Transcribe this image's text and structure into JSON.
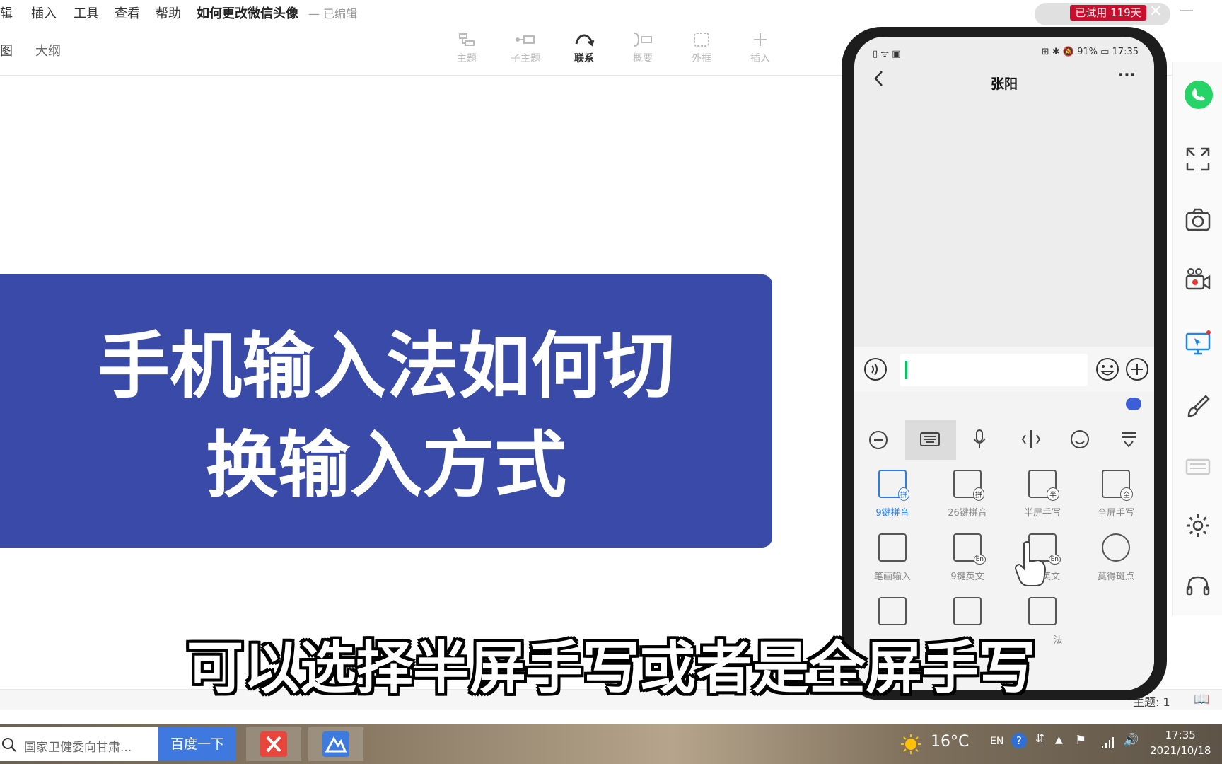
{
  "menu": {
    "items": [
      "辑",
      "插入",
      "工具",
      "查看",
      "帮助"
    ],
    "doc_title": "如何更改微信头像",
    "doc_status": "— 已编辑"
  },
  "trial": {
    "label": "已试用 119天"
  },
  "views": [
    "图",
    "大纲"
  ],
  "toolbar": {
    "tools": [
      {
        "label": "主题"
      },
      {
        "label": "子主题"
      },
      {
        "label": "联系"
      },
      {
        "label": "概要"
      },
      {
        "label": "外框"
      },
      {
        "label": "插入"
      }
    ]
  },
  "canvas": {
    "title_line1": "手机输入法如何切",
    "title_line2": "换输入方式"
  },
  "subtitle": "可以选择半屏手写或者是全屏手写",
  "app_status": {
    "topic_count": "主题: 1"
  },
  "phone": {
    "status_left": "▯ ᯤ ▣",
    "status_right": "⊞ ✱ 🔕 91% ▭ 17:35",
    "contact_name": "张阳",
    "more": "···",
    "keyboard": {
      "row1": [
        {
          "label": "9键拼音",
          "badge": "拼"
        },
        {
          "label": "26键拼音",
          "badge": "拼"
        },
        {
          "label": "半屏手写",
          "badge": "半"
        },
        {
          "label": "全屏手写",
          "badge": "全"
        }
      ],
      "row2": [
        {
          "label": "笔画输入",
          "badge": ""
        },
        {
          "label": "9键英文",
          "badge": "En"
        },
        {
          "label": "英文",
          "badge": "En"
        },
        {
          "label": "莫得斑点",
          "badge": ""
        }
      ],
      "row3_last_label": "法"
    }
  },
  "taskbar": {
    "search_text": "国家卫健委向甘肃...",
    "search_button": "百度一下",
    "weather": "16°C",
    "lang": "EN",
    "time": "17:35",
    "date": "2021/10/18"
  },
  "colors": {
    "title_box": "#3a4aa8",
    "search_button": "#3f79e0",
    "trial_badge": "#c8102e",
    "accent_green": "#07c160"
  }
}
